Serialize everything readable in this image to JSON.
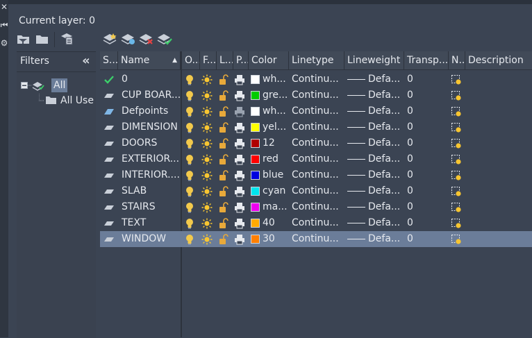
{
  "window": {
    "current_layer_label": "Current layer: 0"
  },
  "filters": {
    "title": "Filters",
    "tree_all": "All",
    "tree_used": "All Use"
  },
  "columns": {
    "status": "S...",
    "name": "Name",
    "on": "O...",
    "freeze": "F...",
    "lock": "L...",
    "plot": "P...",
    "color": "Color",
    "linetype": "Linetype",
    "lineweight": "Lineweight",
    "transparency": "Transp...",
    "newvp": "N...",
    "description": "Description"
  },
  "layers": [
    {
      "status": "current",
      "name": "0",
      "color_name": "wh...",
      "color_hex": "#ffffff",
      "linetype": "Continu...",
      "lineweight": "Defa...",
      "transparency": "0",
      "plot": true,
      "selected": false
    },
    {
      "status": "layer",
      "name": "CUP BOAR...",
      "color_name": "gre...",
      "color_hex": "#00cc00",
      "linetype": "Continu...",
      "lineweight": "Defa...",
      "transparency": "0",
      "plot": true,
      "selected": false
    },
    {
      "status": "defpoints",
      "name": "Defpoints",
      "color_name": "wh...",
      "color_hex": "#ffffff",
      "linetype": "Continu...",
      "lineweight": "Defa...",
      "transparency": "0",
      "plot": false,
      "selected": false
    },
    {
      "status": "layer",
      "name": "DIMENSION",
      "color_name": "yel...",
      "color_hex": "#ffff00",
      "linetype": "Continu...",
      "lineweight": "Defa...",
      "transparency": "0",
      "plot": true,
      "selected": false
    },
    {
      "status": "layer",
      "name": "DOORS",
      "color_name": "12",
      "color_hex": "#b00000",
      "linetype": "Continu...",
      "lineweight": "Defa...",
      "transparency": "0",
      "plot": true,
      "selected": false
    },
    {
      "status": "layer",
      "name": "EXTERIOR...",
      "color_name": "red",
      "color_hex": "#ff0000",
      "linetype": "Continu...",
      "lineweight": "Defa...",
      "transparency": "0",
      "plot": true,
      "selected": false
    },
    {
      "status": "layer",
      "name": "INTERIOR....",
      "color_name": "blue",
      "color_hex": "#0000e0",
      "linetype": "Continu...",
      "lineweight": "Defa...",
      "transparency": "0",
      "plot": true,
      "selected": false
    },
    {
      "status": "layer",
      "name": "SLAB",
      "color_name": "cyan",
      "color_hex": "#00e5ee",
      "linetype": "Continu...",
      "lineweight": "Defa...",
      "transparency": "0",
      "plot": true,
      "selected": false
    },
    {
      "status": "layer",
      "name": "STAIRS",
      "color_name": "ma...",
      "color_hex": "#ee00ee",
      "linetype": "Continu...",
      "lineweight": "Defa...",
      "transparency": "0",
      "plot": true,
      "selected": false
    },
    {
      "status": "layer",
      "name": "TEXT",
      "color_name": "40",
      "color_hex": "#ffaa00",
      "linetype": "Continu...",
      "lineweight": "Defa...",
      "transparency": "0",
      "plot": true,
      "selected": false
    },
    {
      "status": "layer",
      "name": "WINDOW",
      "color_name": "30",
      "color_hex": "#ff7f00",
      "linetype": "Continu...",
      "lineweight": "Defa...",
      "transparency": "0",
      "plot": true,
      "selected": true
    }
  ],
  "colors": {
    "bulb": "#f2c94c",
    "sun": "#f7c531",
    "lock": "#e8a93a",
    "check": "#3ccf6a",
    "selection": "#6b7d99"
  },
  "icons": {
    "side": [
      "close-icon",
      "rewind-icon",
      "gear-icon"
    ],
    "toolbar": [
      "new-property-filter-icon",
      "new-group-filter-icon",
      "layer-states-manager-icon",
      "new-layer-icon",
      "new-layer-vp-frozen-icon",
      "delete-layer-icon",
      "set-current-icon"
    ]
  }
}
